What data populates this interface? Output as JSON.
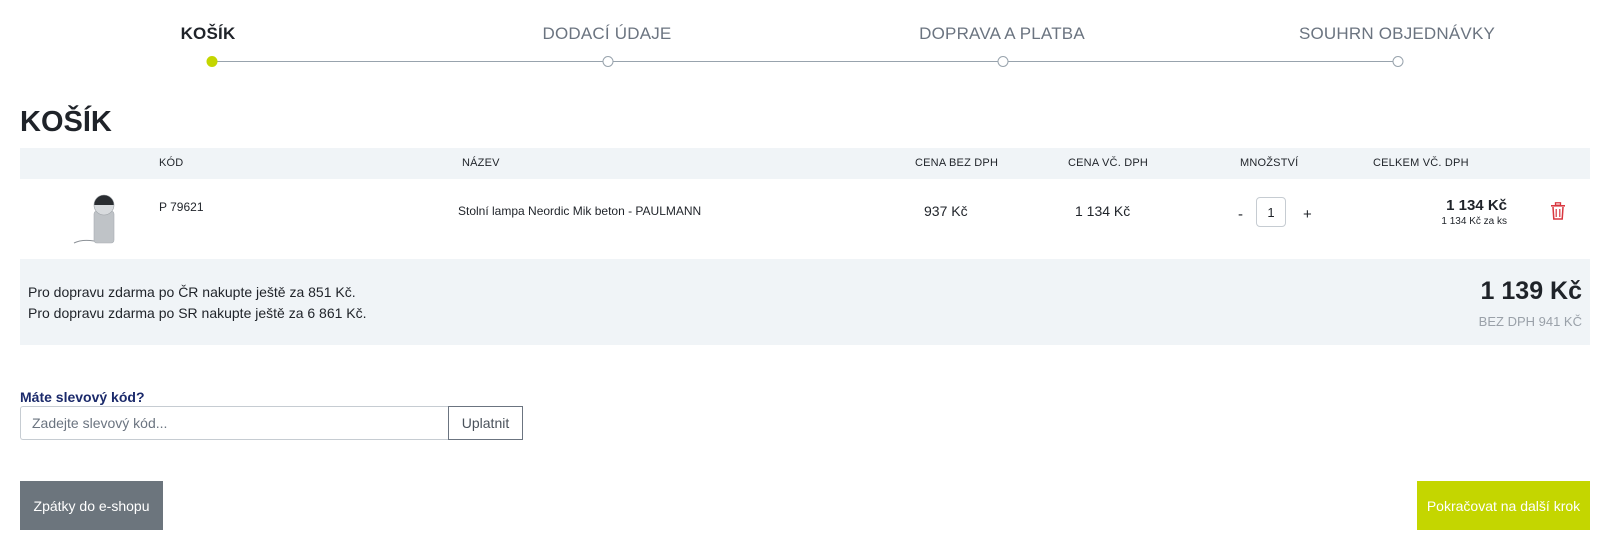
{
  "steps": [
    {
      "label": "KOŠÍK",
      "active": true
    },
    {
      "label": "DODACÍ ÚDAJE",
      "active": false
    },
    {
      "label": "DOPRAVA A PLATBA",
      "active": false
    },
    {
      "label": "SOUHRN OBJEDNÁVKY",
      "active": false
    }
  ],
  "page_title": "KOŠÍK",
  "table": {
    "headers": {
      "code": "KÓD",
      "name": "NÁZEV",
      "price_net": "CENA BEZ DPH",
      "price_gross": "CENA VČ. DPH",
      "quantity": "MNOŽSTVÍ",
      "total": "CELKEM VČ. DPH"
    },
    "items": [
      {
        "image_icon": "table-lamp-image",
        "code": "P 79621",
        "name": "Stolní lampa Neordic Mik beton - PAULMANN",
        "price_net": "937 Kč",
        "price_gross": "1 134 Kč",
        "quantity_minus": "-",
        "quantity": "1",
        "quantity_plus": "+",
        "total": "1 134 Kč",
        "unit_price": "1 134 Kč za ks",
        "delete_icon": "trash-icon"
      }
    ]
  },
  "summary": {
    "shipping_cz": "Pro dopravu zdarma po ČR nakupte ještě za 851 Kč.",
    "shipping_sk": "Pro dopravu zdarma po SR nakupte ještě za 6 861 Kč.",
    "total": "1 139 Kč",
    "total_net": "BEZ DPH 941 KČ"
  },
  "discount": {
    "label": "Máte slevový kód?",
    "placeholder": "Zadejte slevový kód...",
    "apply_label": "Uplatnit"
  },
  "buttons": {
    "back_label": "Zpátky do e-shopu",
    "next_label": "Pokračovat na další krok"
  },
  "colors": {
    "accent": "#c4d600",
    "back_button": "#6c757d",
    "delete_icon": "#d9363e",
    "discount_label": "#1b2a6b"
  }
}
